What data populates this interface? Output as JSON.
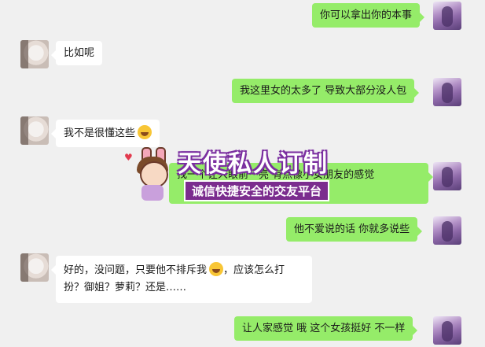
{
  "messages": [
    {
      "side": "right",
      "text": "你可以拿出你的本事"
    },
    {
      "side": "left",
      "text": "比如呢"
    },
    {
      "side": "right",
      "text": "我这里女的太多了 导致大部分没人包"
    },
    {
      "side": "left",
      "text": "我不是很懂这些"
    },
    {
      "side": "right",
      "text": "找一个让人眼前一亮 有点像小女朋友的感觉"
    },
    {
      "side": "right",
      "text": "他不爱说的话 你就多说些"
    },
    {
      "side": "left",
      "line1": "好的，没问题，只要他不排斥我",
      "line1b": "，应该怎么打",
      "line2": "扮？御姐？萝莉？还是……"
    },
    {
      "side": "right",
      "text": "让人家感觉  哦 这个女孩挺好 不一样"
    }
  ],
  "watermark": {
    "title": "天使私人订制",
    "subtitle": "诚信快捷安全的交友平台"
  },
  "emoji_names": [
    "sweat-smile-emoji",
    "laughing-emoji"
  ]
}
